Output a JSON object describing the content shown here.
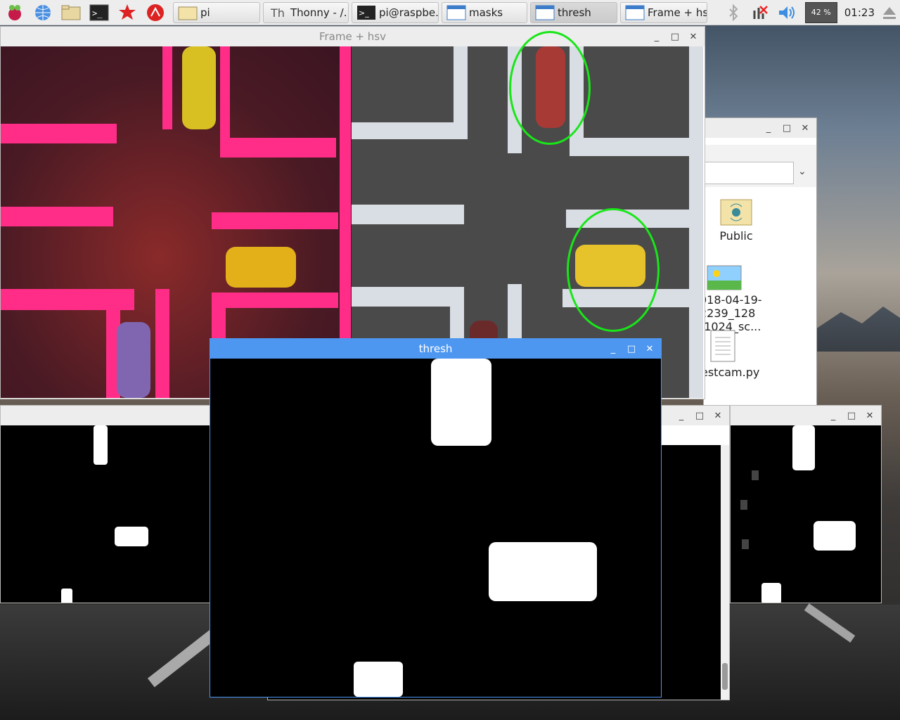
{
  "taskbar": {
    "icons": [
      "raspberry-menu-icon",
      "web-browser-icon",
      "file-manager-icon",
      "terminal-icon",
      "mathematica-icon",
      "wolfram-icon"
    ],
    "buttons": [
      {
        "label": "pi",
        "icon": "folder-icon"
      },
      {
        "label": "Thonny  -  /...",
        "icon": "thonny-icon"
      },
      {
        "label": "pi@raspbe...",
        "icon": "terminal-icon"
      },
      {
        "label": "masks",
        "icon": "window-icon"
      },
      {
        "label": "thresh",
        "icon": "window-icon"
      },
      {
        "label": "Frame + hsv",
        "icon": "window-icon"
      }
    ],
    "tray": {
      "cpu": "42 %",
      "clock": "01:23"
    }
  },
  "windows": {
    "frame_hsv": {
      "title": "Frame + hsv"
    },
    "thresh": {
      "title": "thresh"
    },
    "file_manager": {
      "items": [
        {
          "label": "Public",
          "icon": "public-folder-icon"
        },
        {
          "label": "018-04-19-\n2239_128\n(1024_sc...",
          "icon": "image-file-icon"
        },
        {
          "label": "estcam.py",
          "icon": "text-file-icon"
        }
      ]
    }
  },
  "colors": {
    "accent": "#4d97f1",
    "detection_ring": "#19e619",
    "hsv_tape": "#ff2d88"
  }
}
